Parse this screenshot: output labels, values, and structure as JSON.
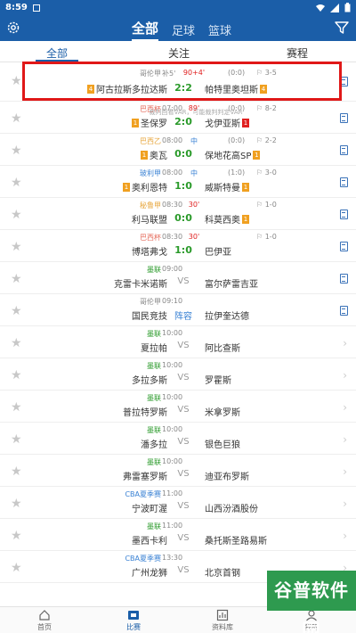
{
  "status_bar": {
    "time": "8:59"
  },
  "header": {
    "tabs": [
      {
        "label": "全部"
      },
      {
        "label": "足球"
      },
      {
        "label": "篮球"
      }
    ]
  },
  "sub_tabs": [
    {
      "label": "全部"
    },
    {
      "label": "关注"
    },
    {
      "label": "赛程"
    }
  ],
  "colors": {
    "brand": "#1b5ea8",
    "score_green": "#2a9a2a",
    "live_red": "#e02020",
    "highlight_red": "#e01818"
  },
  "matches": [
    {
      "league": "哥伦甲",
      "league_color": "#888888",
      "time": "补5'",
      "status": "90+4'",
      "status_color": "#e02020",
      "half": "(0:0)",
      "corner": "⚐ 3-5",
      "home": "阿古拉斯多拉达斯",
      "home_badge": "4",
      "home_badge_type": "y",
      "score": "2:2",
      "score_type": "score",
      "away": "帕特里奥坦斯",
      "away_badge": "4",
      "away_badge_type": "y",
      "icon": "note"
    },
    {
      "league": "巴西杯",
      "league_color": "#e56a5a",
      "time": "07:00",
      "status": "89'",
      "status_color": "#e02020",
      "half": "(0:0)",
      "corner": "⚐ 8-2",
      "home": "圣保罗",
      "home_badge": "1",
      "home_badge_type": "y",
      "score": "2:0",
      "score_type": "score",
      "away": "戈伊亚斯",
      "away_badge": "1",
      "away_badge_type": "r",
      "icon": "note"
    },
    {
      "league": "巴西乙",
      "league_color": "#e7a63c",
      "time": "08:00",
      "status": "中",
      "status_color": "#3a82d4",
      "half": "(0:0)",
      "corner": "⚐ 2-2",
      "home": "奥瓦",
      "home_badge": "1",
      "home_badge_type": "y",
      "score": "0:0",
      "score_type": "score",
      "away": "保地花高SP",
      "away_badge": "1",
      "away_badge_type": "y",
      "icon": "note"
    },
    {
      "league": "玻利甲",
      "league_color": "#3a82d4",
      "time": "08:00",
      "status": "中",
      "status_color": "#3a82d4",
      "half": "(1:0)",
      "corner": "⚐ 3-0",
      "home": "奥利恩特",
      "home_badge": "1",
      "home_badge_type": "y",
      "score": "1:0",
      "score_type": "score",
      "away": "威斯特曼",
      "away_badge": "1",
      "away_badge_type": "y",
      "icon": "note"
    },
    {
      "league": "秘鲁甲",
      "league_color": "#e7a63c",
      "time": "08:30",
      "status": "30'",
      "status_color": "#e02020",
      "half": "",
      "corner": "⚐ 1-0",
      "home": "利马联盟",
      "home_badge": "",
      "home_badge_type": "",
      "score": "0:0",
      "score_type": "score",
      "away": "科莫西奥",
      "away_badge": "1",
      "away_badge_type": "y",
      "icon": "note"
    },
    {
      "league": "巴西杯",
      "league_color": "#e56a5a",
      "time": "08:30",
      "status": "30'",
      "status_color": "#e02020",
      "half": "",
      "corner": "⚐ 1-0",
      "home": "博塔弗戈",
      "home_badge": "",
      "home_badge_type": "",
      "score": "1:0",
      "score_type": "score",
      "away": "巴伊亚",
      "away_badge": "",
      "away_badge_type": "",
      "icon": "note"
    },
    {
      "league": "墨联",
      "league_color": "#2a9a2a",
      "time": "09:00",
      "status": "",
      "status_color": "#888888",
      "half": "",
      "corner": "",
      "home": "克雷卡米诺斯",
      "home_badge": "",
      "home_badge_type": "",
      "score": "VS",
      "score_type": "vs",
      "away": "富尔萨雷吉亚",
      "away_badge": "",
      "away_badge_type": "",
      "icon": "note"
    },
    {
      "league": "哥伦甲",
      "league_color": "#888888",
      "time": "09:10",
      "status": "",
      "status_color": "#888888",
      "half": "",
      "corner": "",
      "home": "国民竞技",
      "home_badge": "",
      "home_badge_type": "",
      "score": "阵容",
      "score_type": "lineup",
      "away": "拉伊奎达德",
      "away_badge": "",
      "away_badge_type": "",
      "icon": "note"
    },
    {
      "league": "墨联",
      "league_color": "#2a9a2a",
      "time": "10:00",
      "status": "",
      "status_color": "#888888",
      "half": "",
      "corner": "",
      "home": "夏拉帕",
      "home_badge": "",
      "home_badge_type": "",
      "score": "VS",
      "score_type": "vs",
      "away": "阿比查斯",
      "away_badge": "",
      "away_badge_type": "",
      "icon": "chevron"
    },
    {
      "league": "墨联",
      "league_color": "#2a9a2a",
      "time": "10:00",
      "status": "",
      "status_color": "#888888",
      "half": "",
      "corner": "",
      "home": "多拉多斯",
      "home_badge": "",
      "home_badge_type": "",
      "score": "VS",
      "score_type": "vs",
      "away": "罗霍斯",
      "away_badge": "",
      "away_badge_type": "",
      "icon": "chevron"
    },
    {
      "league": "墨联",
      "league_color": "#2a9a2a",
      "time": "10:00",
      "status": "",
      "status_color": "#888888",
      "half": "",
      "corner": "",
      "home": "普拉特罗斯",
      "home_badge": "",
      "home_badge_type": "",
      "score": "VS",
      "score_type": "vs",
      "away": "米拿罗斯",
      "away_badge": "",
      "away_badge_type": "",
      "icon": "chevron"
    },
    {
      "league": "墨联",
      "league_color": "#2a9a2a",
      "time": "10:00",
      "status": "",
      "status_color": "#888888",
      "half": "",
      "corner": "",
      "home": "潘多拉",
      "home_badge": "",
      "home_badge_type": "",
      "score": "VS",
      "score_type": "vs",
      "away": "银色巨狼",
      "away_badge": "",
      "away_badge_type": "",
      "icon": "chevron"
    },
    {
      "league": "墨联",
      "league_color": "#2a9a2a",
      "time": "10:00",
      "status": "",
      "status_color": "#888888",
      "half": "",
      "corner": "",
      "home": "弗雷塞罗斯",
      "home_badge": "",
      "home_badge_type": "",
      "score": "VS",
      "score_type": "vs",
      "away": "迪亚布罗斯",
      "away_badge": "",
      "away_badge_type": "",
      "icon": "chevron"
    },
    {
      "league": "CBA夏季赛",
      "league_color": "#3a82d4",
      "time": "11:00",
      "status": "",
      "status_color": "#888888",
      "half": "",
      "corner": "",
      "home": "宁波町渥",
      "home_badge": "",
      "home_badge_type": "",
      "score": "VS",
      "score_type": "vs",
      "away": "山西汾酒股份",
      "away_badge": "",
      "away_badge_type": "",
      "icon": "chevron"
    },
    {
      "league": "墨联",
      "league_color": "#2a9a2a",
      "time": "11:00",
      "status": "",
      "status_color": "#888888",
      "half": "",
      "corner": "",
      "home": "墨西卡利",
      "home_badge": "",
      "home_badge_type": "",
      "score": "VS",
      "score_type": "vs",
      "away": "桑托斯圣路易斯",
      "away_badge": "",
      "away_badge_type": "",
      "icon": "chevron"
    },
    {
      "league": "CBA夏季赛",
      "league_color": "#3a82d4",
      "time": "13:30",
      "status": "",
      "status_color": "#888888",
      "half": "",
      "corner": "",
      "home": "广州龙狮",
      "home_badge": "",
      "home_badge_type": "",
      "score": "VS",
      "score_type": "vs",
      "away": "北京首钢",
      "away_badge": "",
      "away_badge_type": "",
      "icon": "chevron"
    }
  ],
  "overlay_note": "裁判回看VAR，可能裁判判定VAR",
  "bottom_nav": [
    {
      "label": "首页",
      "icon": "home-icon"
    },
    {
      "label": "比赛",
      "icon": "match-icon"
    },
    {
      "label": "资料库",
      "icon": "database-icon"
    },
    {
      "label": "我的",
      "icon": "profile-icon"
    }
  ],
  "watermark_logo": "谷普软件园"
}
